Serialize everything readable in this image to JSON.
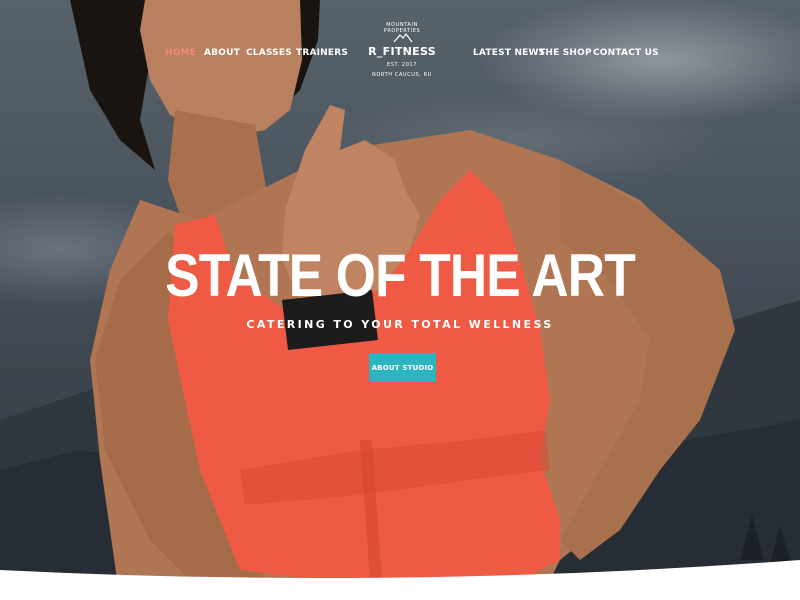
{
  "brand": {
    "ring_top": "MOUNTAIN PROPERTIES",
    "name": "R_FITNESS",
    "established": "EST. 2017",
    "ring_bottom": "NORTH CAUCUS, RU"
  },
  "nav": {
    "left": [
      {
        "label": "HOME",
        "active": true
      },
      {
        "label": "ABOUT",
        "active": false
      },
      {
        "label": "CLASSES",
        "active": false
      },
      {
        "label": "TRAINERS",
        "active": false
      }
    ],
    "right": [
      {
        "label": "LATEST NEWS",
        "active": false
      },
      {
        "label": "THE SHOP",
        "active": false
      },
      {
        "label": "CONTACT US",
        "active": false
      }
    ]
  },
  "hero": {
    "headline": "STATE OF THE ART",
    "subheadline": "CATERING TO YOUR TOTAL WELLNESS",
    "cta_label": "ABOUT STUDIO"
  },
  "colors": {
    "active_nav": "#f08a7a",
    "cta_background": "#2cb5bf",
    "tank_top": "#ef5a45",
    "text": "#ffffff"
  }
}
